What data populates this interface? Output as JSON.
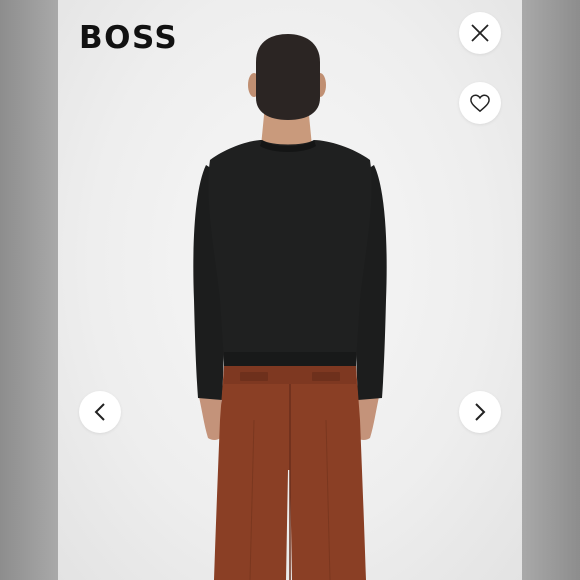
{
  "brand": {
    "logo_text": "BOSS"
  },
  "controls": {
    "close_icon": "close-icon",
    "favorite_icon": "heart-outline-icon",
    "prev_icon": "chevron-left-icon",
    "next_icon": "chevron-right-icon"
  },
  "colors": {
    "sweater": "#1e1f1f",
    "trousers": "#8a3f25",
    "hair": "#2b2523",
    "skin": "#c99a7c",
    "button_bg": "#ffffff"
  }
}
